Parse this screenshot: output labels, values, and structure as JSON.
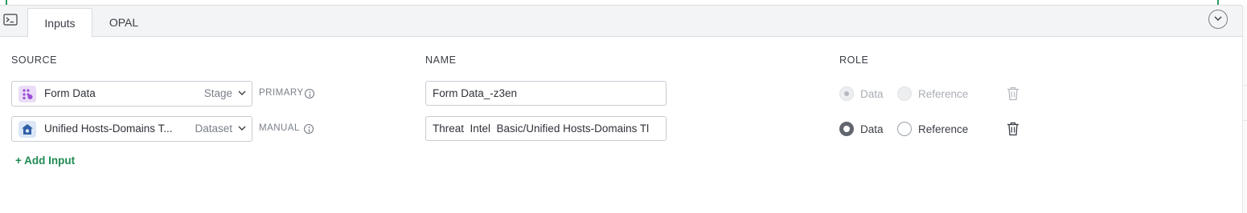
{
  "tabs": [
    {
      "label": "Inputs",
      "active": true
    },
    {
      "label": "OPAL",
      "active": false
    }
  ],
  "columns": {
    "source": "SOURCE",
    "name": "NAME",
    "role": "ROLE"
  },
  "inputs": [
    {
      "source_name": "Form Data",
      "source_kind": "Stage",
      "source_icon": "stage-icon",
      "tag": "PRIMARY",
      "name_value": "Form Data_-z3en",
      "role_options": [
        "Data",
        "Reference"
      ],
      "selected_role": "Data",
      "disabled": true
    },
    {
      "source_name": "Unified Hosts-Domains T...",
      "source_kind": "Dataset",
      "source_icon": "dataset-icon",
      "tag": "MANUAL",
      "name_value": "Threat  Intel  Basic/Unified Hosts-Domains Tl",
      "role_options": [
        "Data",
        "Reference"
      ],
      "selected_role": "Data",
      "disabled": false
    }
  ],
  "add_input_label": "+ Add Input",
  "colors": {
    "accent_green": "#1f8a52",
    "stage_icon_bg": "#eadcf7",
    "dataset_icon_bg": "#dbe7f6"
  }
}
